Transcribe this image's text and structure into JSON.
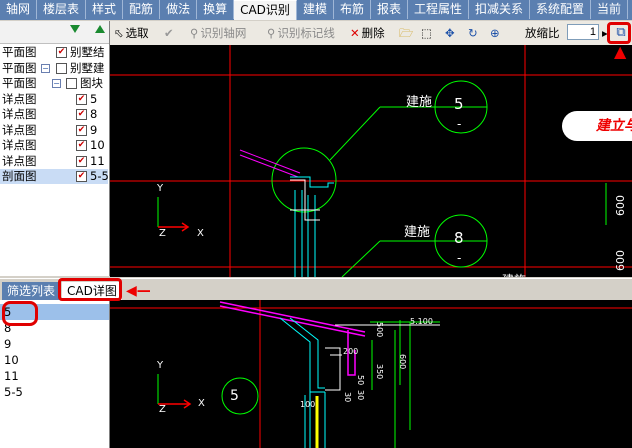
{
  "menu_tabs": [
    "轴网",
    "楼层表",
    "样式",
    "配筋",
    "做法",
    "换算",
    "CAD识别",
    "建模",
    "布筋",
    "报表",
    "工程属性",
    "扣减关系",
    "系统配置",
    "当前"
  ],
  "active_tab": "CAD识别",
  "tree": {
    "rows": [
      {
        "label": "平面图",
        "expand": "",
        "value": "别墅结"
      },
      {
        "label": "平面图",
        "expand": "−",
        "value": "别墅建"
      },
      {
        "label": "平面图",
        "expand": "−",
        "value": "图块"
      },
      {
        "label": "详点图",
        "expand": "",
        "value": "5"
      },
      {
        "label": "详点图",
        "expand": "",
        "value": "8"
      },
      {
        "label": "详点图",
        "expand": "",
        "value": "9"
      },
      {
        "label": "详点图",
        "expand": "",
        "value": "10"
      },
      {
        "label": "详点图",
        "expand": "",
        "value": "11"
      },
      {
        "label": "剖面图",
        "expand": "",
        "value": "5-5"
      }
    ]
  },
  "toolbar": {
    "select_label": "选取",
    "identify_axis_label": "识别轴网",
    "identify_mark_label": "识别标记线",
    "delete_label": "删除",
    "scale_label": "放缩比",
    "scale_value": "1"
  },
  "cad_main": {
    "labels": [
      "建施",
      "5",
      "-",
      "建施",
      "8",
      "-",
      "建施",
      "600",
      "600"
    ],
    "axis_x": "X",
    "axis_y": "Y",
    "axis_z": "Z"
  },
  "callout_text": "建立与详图的关联",
  "bottom_tabs": {
    "filter": "筛选列表",
    "detail": "CAD详图"
  },
  "detail_list": [
    "5",
    "8",
    "9",
    "10",
    "11",
    "5-5"
  ],
  "selected_detail": "5",
  "cad_detail": {
    "circle_label": "5",
    "labels": [
      "5.100",
      "600",
      "500",
      "200",
      "50",
      "100",
      "30",
      "30",
      "350"
    ],
    "axis_x": "X",
    "axis_y": "Y",
    "axis_z": "Z"
  },
  "colors": {
    "tab_bar": "#5b7fb0",
    "canvas": "#000000",
    "cad_green": "#00ff00",
    "cad_red": "#ff0000",
    "cad_magenta": "#ff00ff",
    "cad_yellow": "#ffff00",
    "annotation": "#e00000"
  }
}
